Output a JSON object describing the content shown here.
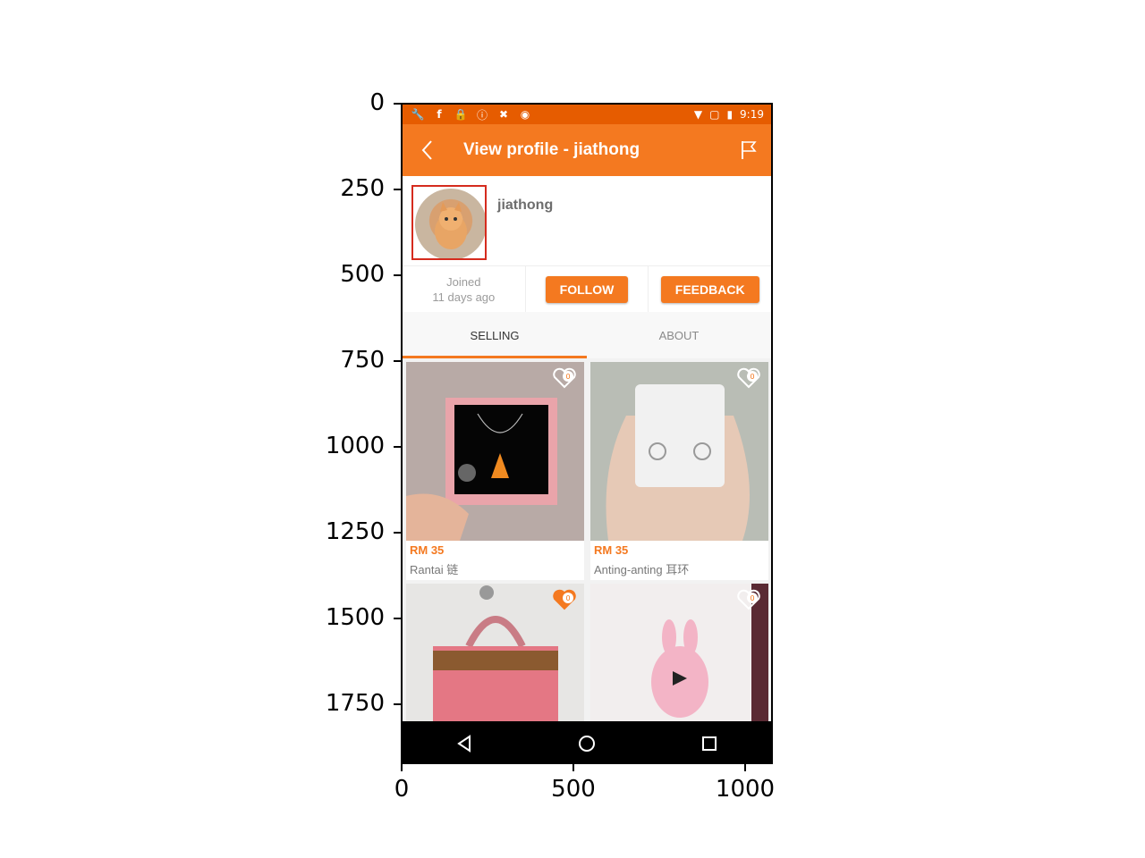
{
  "axes": {
    "y_ticks": [
      "0",
      "250",
      "500",
      "750",
      "1000",
      "1250",
      "1500",
      "1750"
    ],
    "x_ticks": [
      "0",
      "500",
      "1000"
    ]
  },
  "statusbar": {
    "time": "9:19",
    "icons": [
      "wrench-icon",
      "facebook-icon",
      "lock-icon",
      "alert-icon",
      "tools-icon",
      "android-icon"
    ],
    "right_icons": [
      "wifi-icon",
      "no-sim-icon",
      "battery-icon"
    ]
  },
  "appbar": {
    "title": "View profile - jiathong",
    "back_icon": "back-icon",
    "flag_icon": "flag-icon"
  },
  "profile": {
    "username": "jiathong",
    "joined_label": "Joined",
    "joined_value": "11 days ago",
    "follow_label": "FOLLOW",
    "feedback_label": "FEEDBACK"
  },
  "tabs": [
    {
      "label": "SELLING",
      "active": true
    },
    {
      "label": "ABOUT",
      "active": false
    }
  ],
  "products": [
    {
      "price": "RM 35",
      "name": "Rantai 链",
      "likes": "0",
      "liked": false
    },
    {
      "price": "RM 35",
      "name": "Anting-anting 耳环",
      "likes": "0",
      "liked": false
    },
    {
      "price": "",
      "name": "",
      "likes": "0",
      "liked": true
    },
    {
      "price": "",
      "name": "",
      "likes": "0",
      "liked": false
    }
  ],
  "colors": {
    "accent": "#f47920",
    "statusbar": "#e65c00",
    "highlight_box": "#d52b1e"
  }
}
